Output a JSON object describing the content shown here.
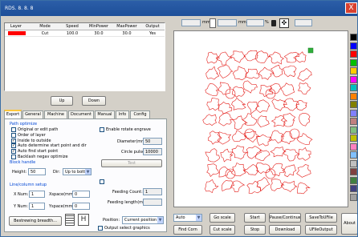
{
  "window": {
    "title": "RDS. 8. 8. 8",
    "close": "X"
  },
  "table": {
    "headers": [
      "Layer",
      "Mode",
      "Speed",
      "MinPower",
      "MaxPower",
      "Output"
    ],
    "rows": [
      [
        "",
        "Cut",
        "100.0",
        "30.0",
        "30.0",
        "Yes"
      ]
    ],
    "layer_color": "#ff0000"
  },
  "table_buttons": {
    "up": "Up",
    "down": "Down"
  },
  "tabs": [
    "Export",
    "General",
    "Machine",
    "Document",
    "Manual",
    "Info",
    "Config"
  ],
  "export": {
    "path_group": "Path optimize",
    "options": [
      {
        "label": "Original or edit path",
        "checked": false
      },
      {
        "label": "Order of layer",
        "checked": false
      },
      {
        "label": "Inside to outside",
        "checked": true
      },
      {
        "label": "Auto determine start point and dir",
        "checked": true
      },
      {
        "label": "Auto find start point",
        "checked": true
      },
      {
        "label": "Backlash negav optimize",
        "checked": false
      }
    ],
    "block_group": "Block handle",
    "height_label": "Height:",
    "height_value": "50",
    "dir_label": "Dir:",
    "dir_value": "Up to bott",
    "rotate_label": "Enable rotate engrave",
    "diameter_label": "Diameter(mm):",
    "diameter_value": "50",
    "circle_pulse_label": "Circle pulse:",
    "circle_pulse_value": "10000",
    "test_label": "Test",
    "feeding_count_label": "Feeding Count:",
    "feeding_count_value": "1",
    "feeding_length_label": "Feeding length(mm):",
    "array_group": "Line/column setup",
    "xnum_label": "X Num:",
    "xnum_value": "1",
    "xspace_label": "Xspace(mm):",
    "xspace_value": "0",
    "ynum_label": "Y Num:",
    "ynum_value": "1",
    "yspace_label": "Yspace(mm):",
    "yspace_value": "0",
    "breadth_button": "Bestrewing breadth...",
    "position_label": "Position:",
    "position_value": "Current position",
    "output_select_label": "Output select graphics"
  },
  "toolbar": {
    "mm1": "mm",
    "mm2": "mm",
    "mm3": "mm",
    "mm4": "mm",
    "pct1": "%",
    "pct2": "%",
    "lock_icon": "lock-icon",
    "center_icon": "center-icon"
  },
  "controls": {
    "mode_select": "Auto",
    "go_scale": "Go scale",
    "find_corn": "Find Corn",
    "cut_scale": "Cut scale",
    "start": "Start",
    "pause": "Pause/Continue",
    "save_to_file": "SaveToUFile",
    "stop": "Stop",
    "download": "Download",
    "ufile_output": "UFileOutput",
    "about": "About"
  },
  "palette": [
    "#000000",
    "#0000ff",
    "#ff0000",
    "#00c000",
    "#ffcc00",
    "#ff00ff",
    "#00c0c0",
    "#ff8000",
    "#808000",
    "#8080ff",
    "#c08080",
    "#80c080",
    "#c0c000",
    "#ff80c0",
    "#80c0ff",
    "#c0c0c0",
    "#804040",
    "#408040",
    "#404080",
    "#a0a0a0"
  ],
  "accent": "#e41b17"
}
